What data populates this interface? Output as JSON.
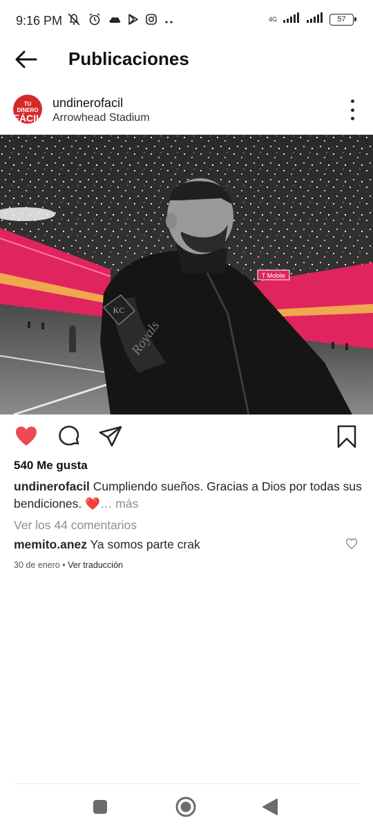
{
  "status_bar": {
    "time": "9:16 PM",
    "network_label": "4G",
    "battery": "57",
    "icons_left": [
      "mute-icon",
      "alarm-icon",
      "cloud-icon",
      "play-store-icon",
      "instagram-icon",
      "more-dots-icon"
    ],
    "icons_right": [
      "signal-icon",
      "signal-icon-2",
      "battery-icon"
    ]
  },
  "header": {
    "title": "Publicaciones",
    "back_icon": "arrow-left-icon"
  },
  "post": {
    "avatar_text_small": "TU DINERO",
    "avatar_text_big": "FÁCIL",
    "username": "undinerofacil",
    "location": "Arrowhead Stadium",
    "photo_signage": "T Mobile",
    "likes": "540 Me gusta",
    "caption_user": "undinerofacil",
    "caption_text": " Cumpliendo sueños. Gracias a Dios por todas sus bendiciones. ❤️",
    "caption_more": "… más",
    "view_comments": "Ver los 44 comentarios",
    "comment_user": "memito.anez",
    "comment_text": " Ya somos parte crak",
    "date": "30 de enero",
    "separator": " • ",
    "translate": "Ver traducción"
  },
  "colors": {
    "like_red": "#ed4956",
    "avatar_red": "#d62a2a",
    "stadium_pink": "#e0245e",
    "muted_text": "#8e8e8e"
  }
}
